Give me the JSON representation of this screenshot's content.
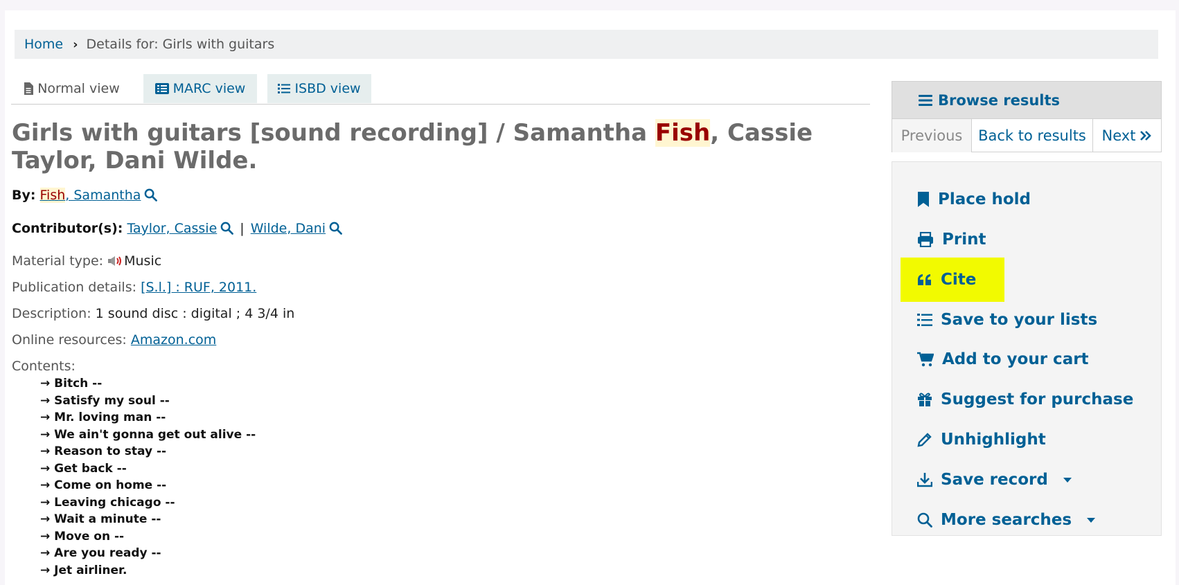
{
  "breadcrumb": {
    "home": "Home",
    "current": "Details for: Girls with guitars"
  },
  "tabs": {
    "normal": "Normal view",
    "marc": "MARC view",
    "isbd": "ISBD view"
  },
  "record": {
    "title_before": "Girls with guitars [sound recording] / Samantha ",
    "title_highlight": "Fish",
    "title_after": ", Cassie Taylor, Dani Wilde.",
    "by_label": "By:",
    "author_highlight": "Fish",
    "author_rest": ", Samantha",
    "contributors_label": "Contributor(s):",
    "contributor_1": "Taylor, Cassie",
    "contributor_sep": "|",
    "contributor_2": "Wilde, Dani",
    "material_label": "Material type:",
    "material_value": "Music",
    "publication_label": "Publication details:",
    "publication_value": "[S.l.] : RUF, 2011.",
    "description_label": "Description:",
    "description_value": "1 sound disc : digital ; 4 3/4 in",
    "online_label": "Online resources:",
    "online_value": "Amazon.com",
    "contents_label": "Contents:",
    "contents": [
      "→ Bitch --",
      "→ Satisfy my soul --",
      "→ Mr. loving man --",
      "→ We ain't gonna get out alive --",
      "→ Reason to stay --",
      "→ Get back --",
      "→ Come on home --",
      "→ Leaving chicago --",
      "→ Wait a minute --",
      "→ Move on --",
      "→ Are you ready --",
      "→ Jet airliner."
    ]
  },
  "browse": {
    "title": "Browse results",
    "previous": "Previous",
    "back": "Back to results",
    "next": "Next"
  },
  "actions": {
    "place_hold": "Place hold",
    "print": "Print",
    "cite": "Cite",
    "save_lists": "Save to your lists",
    "add_cart": "Add to your cart",
    "suggest": "Suggest for purchase",
    "unhighlight": "Unhighlight",
    "save_record": "Save record",
    "more_searches": "More searches"
  },
  "colors": {
    "link": "#006095",
    "highlight": "#f2fa00",
    "term_highlight_bg": "#fff6d1",
    "term_highlight_fg": "#990000"
  },
  "icons": [
    "file-icon",
    "list-alt-icon",
    "list-icon",
    "search-icon",
    "bookmark-icon",
    "print-icon",
    "quote-icon",
    "cart-icon",
    "gift-icon",
    "pencil-icon",
    "download-icon",
    "chevron-double-right-icon",
    "music-type-icon"
  ]
}
